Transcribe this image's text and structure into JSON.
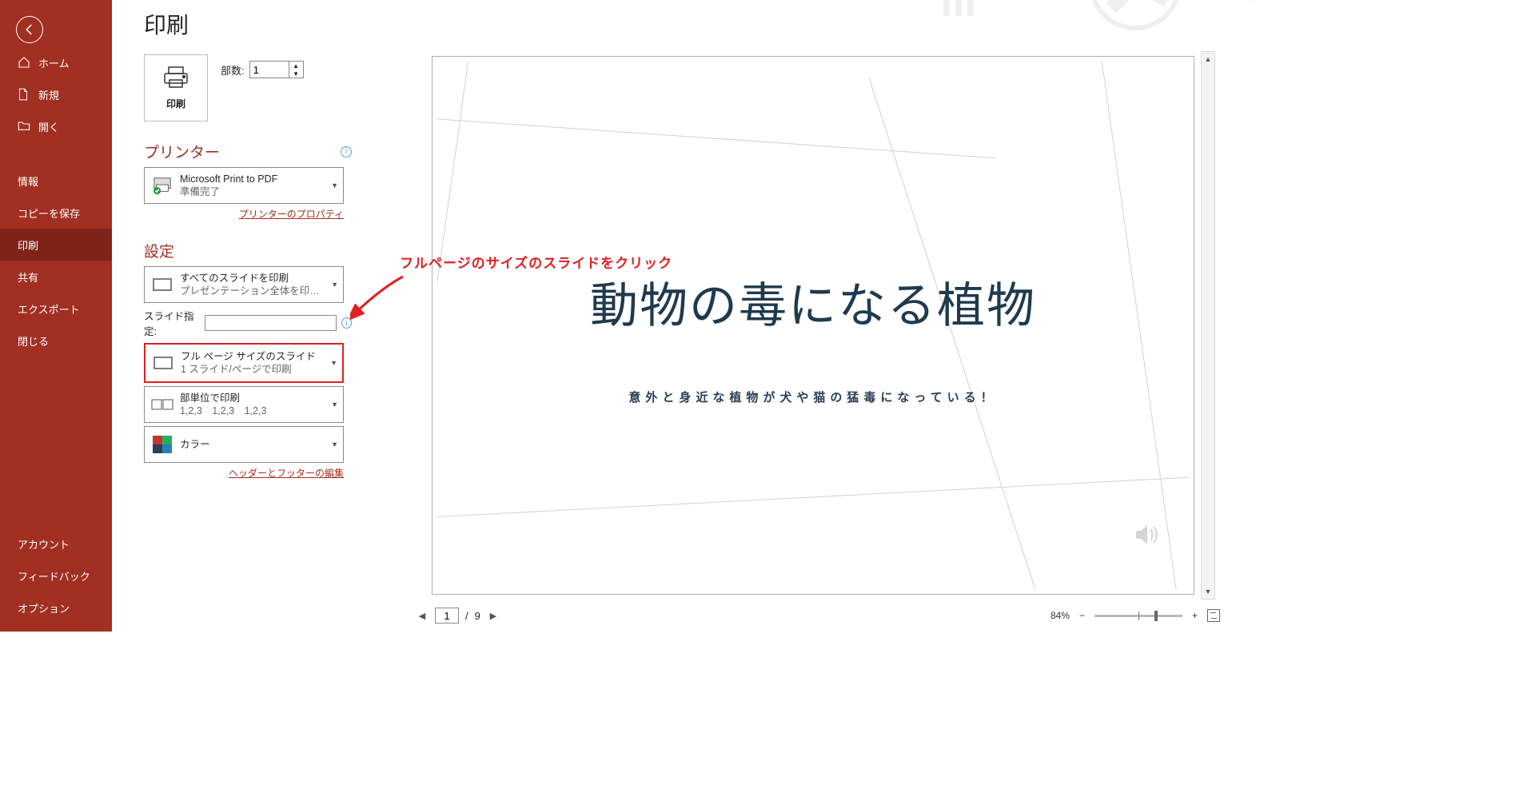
{
  "nav": {
    "home": "ホーム",
    "new": "新規",
    "open": "開く",
    "info": "情報",
    "saveCopy": "コピーを保存",
    "print": "印刷",
    "share": "共有",
    "export": "エクスポート",
    "close": "閉じる",
    "account": "アカウント",
    "feedback": "フィードバック",
    "options": "オプション"
  },
  "print": {
    "title": "印刷",
    "buttonLabel": "印刷",
    "copiesLabel": "部数:",
    "copiesValue": "1"
  },
  "printer": {
    "heading": "プリンター",
    "name": "Microsoft Print to PDF",
    "status": "準備完了",
    "propsLink": "プリンターのプロパティ"
  },
  "settings": {
    "heading": "設定",
    "range": {
      "l1": "すべてのスライドを印刷",
      "l2": "プレゼンテーション全体を印刷し…"
    },
    "slideSpecLabel": "スライド指定:",
    "slideSpecValue": "",
    "layout": {
      "l1": "フル ページ サイズのスライド",
      "l2": "1 スライド/ページで印刷"
    },
    "collate": {
      "l1": "部単位で印刷",
      "l2": "1,2,3　1,2,3　1,2,3"
    },
    "color": {
      "l1": "カラー"
    },
    "hfLink": "ヘッダーとフッターの編集"
  },
  "preview": {
    "slideTitle": "動物の毒になる植物",
    "slideSubtitle": "意外と身近な植物が犬や猫の猛毒になっている！",
    "currentPage": "1",
    "totalPages": "9",
    "zoom": "84%"
  },
  "annotation": {
    "text": "フルページのサイズのスライドをクリック"
  }
}
